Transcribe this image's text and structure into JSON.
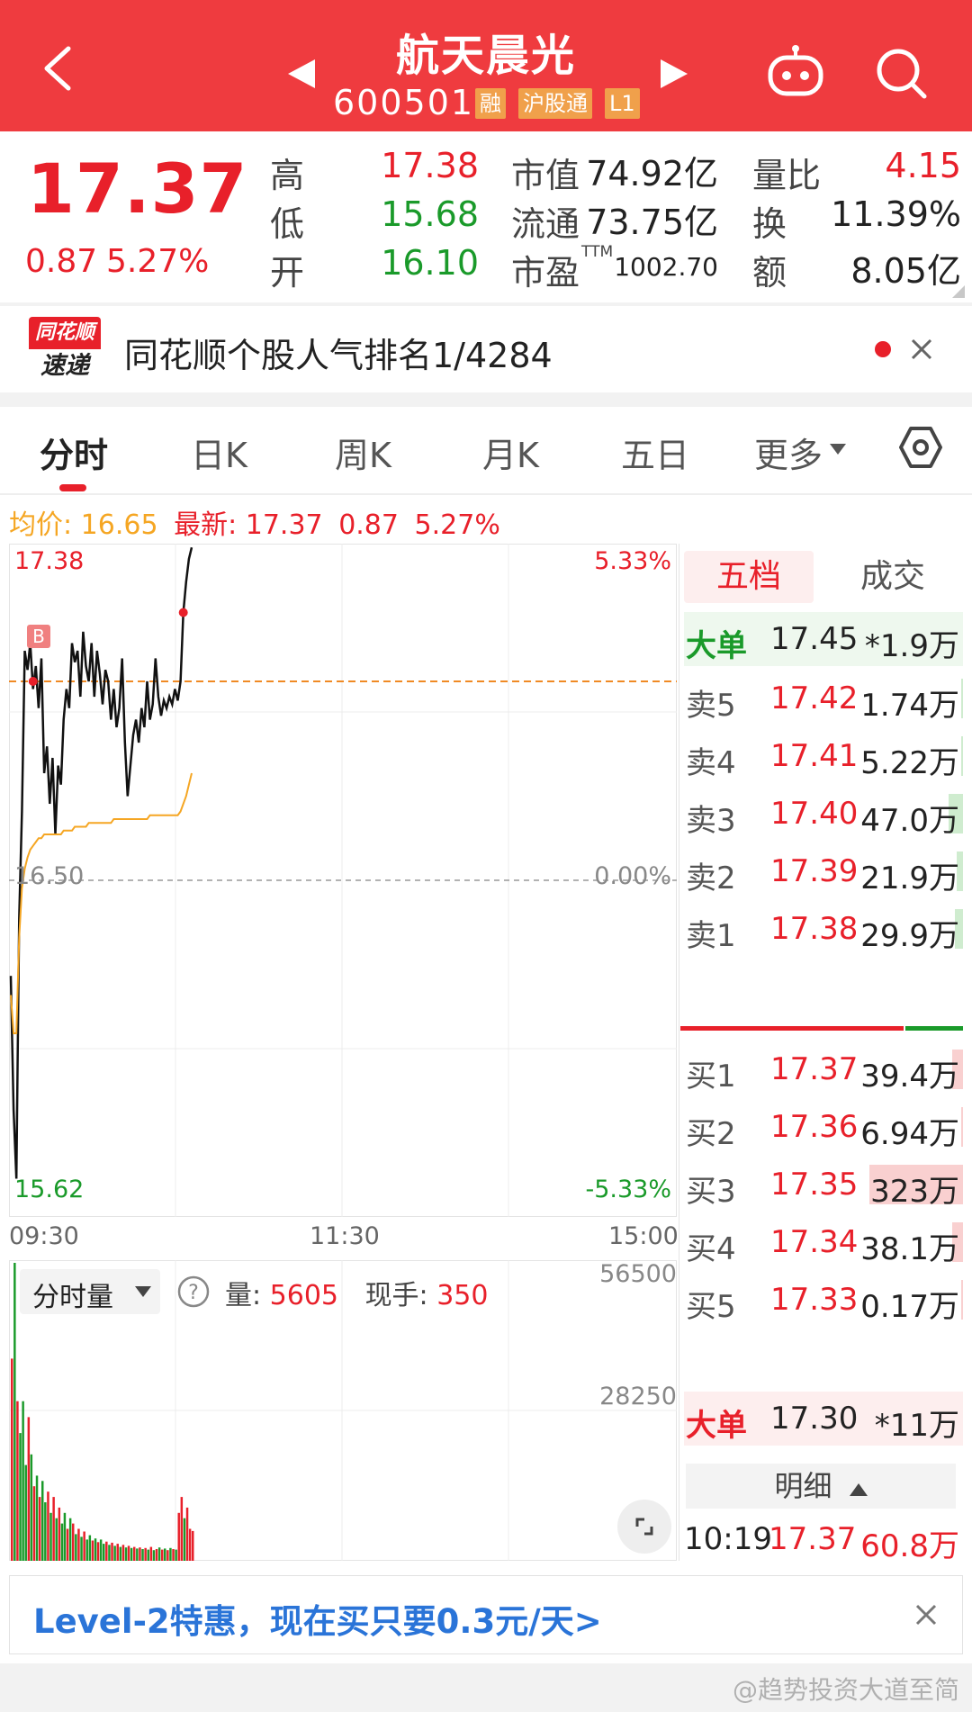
{
  "header": {
    "stock_name": "航天晨光",
    "stock_code": "600501",
    "tags": [
      "融",
      "沪股通",
      "L1"
    ],
    "bg_color": "#ef3b3f"
  },
  "quote": {
    "price": "17.37",
    "change": "0.87",
    "change_pct": "5.27%",
    "high_label": "高",
    "high": "17.38",
    "low_label": "低",
    "low": "15.68",
    "open_label": "开",
    "open": "16.10",
    "mcap_label": "市值",
    "mcap": "74.92亿",
    "float_label": "流通",
    "float": "73.75亿",
    "pe_label": "市盈",
    "pe_sup": "TTM",
    "pe": "1002.70",
    "vr_label": "量比",
    "vr": "4.15",
    "turnover_label": "换",
    "turnover": "11.39%",
    "amount_label": "额",
    "amount": "8.05亿"
  },
  "banner": {
    "logo_top": "同花顺",
    "logo_bottom": "速递",
    "text": "同花顺个股人气排名1/4284"
  },
  "tabs": [
    "分时",
    "日K",
    "周K",
    "月K",
    "五日",
    "更多"
  ],
  "info_line": {
    "avg_label": "均价:",
    "avg": "16.65",
    "last_label": "最新:",
    "last": "17.37",
    "chg": "0.87",
    "chg_pct": "5.27%"
  },
  "chart_data": {
    "type": "line",
    "title": "",
    "x_labels": [
      "09:30",
      "11:30",
      "15:00"
    ],
    "y_left_labels": [
      "17.38",
      "16.50",
      "15.62"
    ],
    "y_right_labels": [
      "5.33%",
      "0.00%",
      "-5.33%"
    ],
    "ylim": [
      15.62,
      17.38
    ],
    "marker": "B",
    "series": [
      {
        "name": "",
        "color": "#111111",
        "x": [
          0,
          1,
          2,
          3,
          4,
          5,
          6,
          7,
          8,
          9,
          10,
          11,
          12,
          13,
          14,
          15,
          16,
          17,
          18,
          19,
          20,
          21,
          22,
          23,
          24,
          25,
          26,
          27,
          28,
          29,
          30,
          31,
          32,
          33,
          34,
          35,
          36,
          37,
          38,
          39,
          40,
          41,
          42,
          43,
          44,
          45,
          46,
          47,
          48,
          49,
          50,
          51,
          52,
          53,
          54,
          55,
          56,
          57,
          58,
          59,
          60,
          61,
          62,
          63,
          64,
          65
        ],
        "values": [
          16.25,
          15.9,
          15.72,
          16.4,
          16.68,
          17.1,
          17.05,
          17.12,
          17.0,
          17.06,
          16.95,
          17.08,
          16.78,
          16.85,
          16.7,
          16.82,
          16.62,
          16.8,
          16.75,
          16.92,
          17.0,
          16.95,
          17.12,
          17.07,
          17.1,
          16.98,
          17.15,
          17.06,
          17.02,
          17.12,
          16.98,
          17.1,
          17.04,
          16.96,
          17.05,
          17.02,
          16.92,
          17.0,
          16.9,
          16.95,
          17.08,
          16.86,
          16.72,
          16.8,
          16.88,
          16.92,
          16.86,
          16.95,
          16.9,
          17.02,
          16.92,
          16.96,
          17.08,
          16.98,
          16.93,
          16.97,
          16.95,
          16.98,
          16.96,
          17.0,
          16.97,
          17.02,
          17.2,
          17.28,
          17.34,
          17.37
        ]
      },
      {
        "name": "",
        "color": "#f5a623",
        "x": [
          0,
          1,
          2,
          3,
          4,
          5,
          6,
          7,
          8,
          9,
          10,
          11,
          12,
          13,
          14,
          15,
          16,
          17,
          18,
          19,
          20,
          21,
          22,
          23,
          24,
          25,
          26,
          27,
          28,
          29,
          30,
          31,
          32,
          33,
          34,
          35,
          36,
          37,
          38,
          39,
          40,
          41,
          42,
          43,
          44,
          45,
          46,
          47,
          48,
          49,
          50,
          51,
          52,
          53,
          54,
          55,
          56,
          57,
          58,
          59,
          60,
          61,
          62,
          63,
          64,
          65
        ],
        "values": [
          16.2,
          16.1,
          16.1,
          16.35,
          16.48,
          16.53,
          16.56,
          16.58,
          16.59,
          16.6,
          16.61,
          16.61,
          16.62,
          16.62,
          16.62,
          16.62,
          16.62,
          16.62,
          16.62,
          16.63,
          16.63,
          16.63,
          16.63,
          16.64,
          16.64,
          16.64,
          16.64,
          16.64,
          16.65,
          16.65,
          16.65,
          16.65,
          16.65,
          16.65,
          16.65,
          16.65,
          16.65,
          16.66,
          16.66,
          16.66,
          16.66,
          16.66,
          16.66,
          16.66,
          16.66,
          16.66,
          16.66,
          16.66,
          16.66,
          16.66,
          16.67,
          16.67,
          16.67,
          16.67,
          16.67,
          16.67,
          16.67,
          16.67,
          16.67,
          16.67,
          16.67,
          16.68,
          16.7,
          16.72,
          16.75,
          16.78
        ]
      }
    ],
    "reference_line": 17.02
  },
  "volume": {
    "selector": "分时量",
    "vol_label": "量:",
    "vol": "5605",
    "hand_label": "现手:",
    "hand": "350",
    "y_labels": [
      "56500",
      "28250"
    ],
    "ymax": 56500,
    "bars": [
      {
        "v": 38000,
        "c": "r"
      },
      {
        "v": 56000,
        "c": "g"
      },
      {
        "v": 30000,
        "c": "r"
      },
      {
        "v": 24000,
        "c": "g"
      },
      {
        "v": 30000,
        "c": "g"
      },
      {
        "v": 18000,
        "c": "g"
      },
      {
        "v": 27000,
        "c": "r"
      },
      {
        "v": 20000,
        "c": "g"
      },
      {
        "v": 14000,
        "c": "r"
      },
      {
        "v": 16000,
        "c": "g"
      },
      {
        "v": 12000,
        "c": "r"
      },
      {
        "v": 15000,
        "c": "g"
      },
      {
        "v": 11000,
        "c": "g"
      },
      {
        "v": 13000,
        "c": "r"
      },
      {
        "v": 9000,
        "c": "g"
      },
      {
        "v": 12000,
        "c": "r"
      },
      {
        "v": 8000,
        "c": "g"
      },
      {
        "v": 10000,
        "c": "r"
      },
      {
        "v": 7000,
        "c": "g"
      },
      {
        "v": 9000,
        "c": "g"
      },
      {
        "v": 6000,
        "c": "r"
      },
      {
        "v": 8000,
        "c": "g"
      },
      {
        "v": 7000,
        "c": "r"
      },
      {
        "v": 5000,
        "c": "g"
      },
      {
        "v": 6000,
        "c": "r"
      },
      {
        "v": 4500,
        "c": "g"
      },
      {
        "v": 5500,
        "c": "r"
      },
      {
        "v": 4000,
        "c": "g"
      },
      {
        "v": 4800,
        "c": "g"
      },
      {
        "v": 3800,
        "c": "r"
      },
      {
        "v": 4200,
        "c": "g"
      },
      {
        "v": 3500,
        "c": "r"
      },
      {
        "v": 4000,
        "c": "g"
      },
      {
        "v": 3200,
        "c": "g"
      },
      {
        "v": 3600,
        "c": "r"
      },
      {
        "v": 3000,
        "c": "g"
      },
      {
        "v": 3400,
        "c": "r"
      },
      {
        "v": 2800,
        "c": "g"
      },
      {
        "v": 3200,
        "c": "r"
      },
      {
        "v": 2600,
        "c": "g"
      },
      {
        "v": 3000,
        "c": "r"
      },
      {
        "v": 2500,
        "c": "g"
      },
      {
        "v": 2800,
        "c": "r"
      },
      {
        "v": 2400,
        "c": "g"
      },
      {
        "v": 2600,
        "c": "r"
      },
      {
        "v": 2300,
        "c": "g"
      },
      {
        "v": 2500,
        "c": "r"
      },
      {
        "v": 2200,
        "c": "g"
      },
      {
        "v": 2400,
        "c": "r"
      },
      {
        "v": 2100,
        "c": "g"
      },
      {
        "v": 2600,
        "c": "r"
      },
      {
        "v": 2000,
        "c": "g"
      },
      {
        "v": 2200,
        "c": "r"
      },
      {
        "v": 2500,
        "c": "g"
      },
      {
        "v": 2100,
        "c": "r"
      },
      {
        "v": 2300,
        "c": "g"
      },
      {
        "v": 2000,
        "c": "r"
      },
      {
        "v": 2400,
        "c": "g"
      },
      {
        "v": 2200,
        "c": "r"
      },
      {
        "v": 2100,
        "c": "g"
      },
      {
        "v": 9000,
        "c": "r"
      },
      {
        "v": 12000,
        "c": "r"
      },
      {
        "v": 8000,
        "c": "g"
      },
      {
        "v": 10000,
        "c": "r"
      },
      {
        "v": 6000,
        "c": "r"
      },
      {
        "v": 5605,
        "c": "r"
      }
    ]
  },
  "orderbook": {
    "tab_active": "五档",
    "tab_other": "成交",
    "big_sell": {
      "name": "大单",
      "price": "17.45",
      "vol": "*1.9万"
    },
    "sells": [
      {
        "name": "卖5",
        "price": "17.42",
        "vol": "1.74万",
        "level": 0.01
      },
      {
        "name": "卖4",
        "price": "17.41",
        "vol": "5.22万",
        "level": 0.02
      },
      {
        "name": "卖3",
        "price": "17.40",
        "vol": "47.0万",
        "level": 0.15
      },
      {
        "name": "卖2",
        "price": "17.39",
        "vol": "21.9万",
        "level": 0.07
      },
      {
        "name": "卖1",
        "price": "17.38",
        "vol": "29.9万",
        "level": 0.09
      }
    ],
    "buys": [
      {
        "name": "买1",
        "price": "17.37",
        "vol": "39.4万",
        "level": 0.12
      },
      {
        "name": "买2",
        "price": "17.36",
        "vol": "6.94万",
        "level": 0.02
      },
      {
        "name": "买3",
        "price": "17.35",
        "vol": "323万",
        "level": 1.0
      },
      {
        "name": "买4",
        "price": "17.34",
        "vol": "38.1万",
        "level": 0.12
      },
      {
        "name": "买5",
        "price": "17.33",
        "vol": "0.17万",
        "level": 0.01
      }
    ],
    "big_buy": {
      "name": "大单",
      "price": "17.30",
      "vol": "*11万"
    },
    "detail_label": "明细",
    "detail_row": {
      "time": "10:19",
      "price": "17.37",
      "vol": "60.8万"
    }
  },
  "promo": {
    "text": "Level-2特惠，现在买只要0.3元/天>"
  },
  "watermark": "@趋势投资大道至简"
}
